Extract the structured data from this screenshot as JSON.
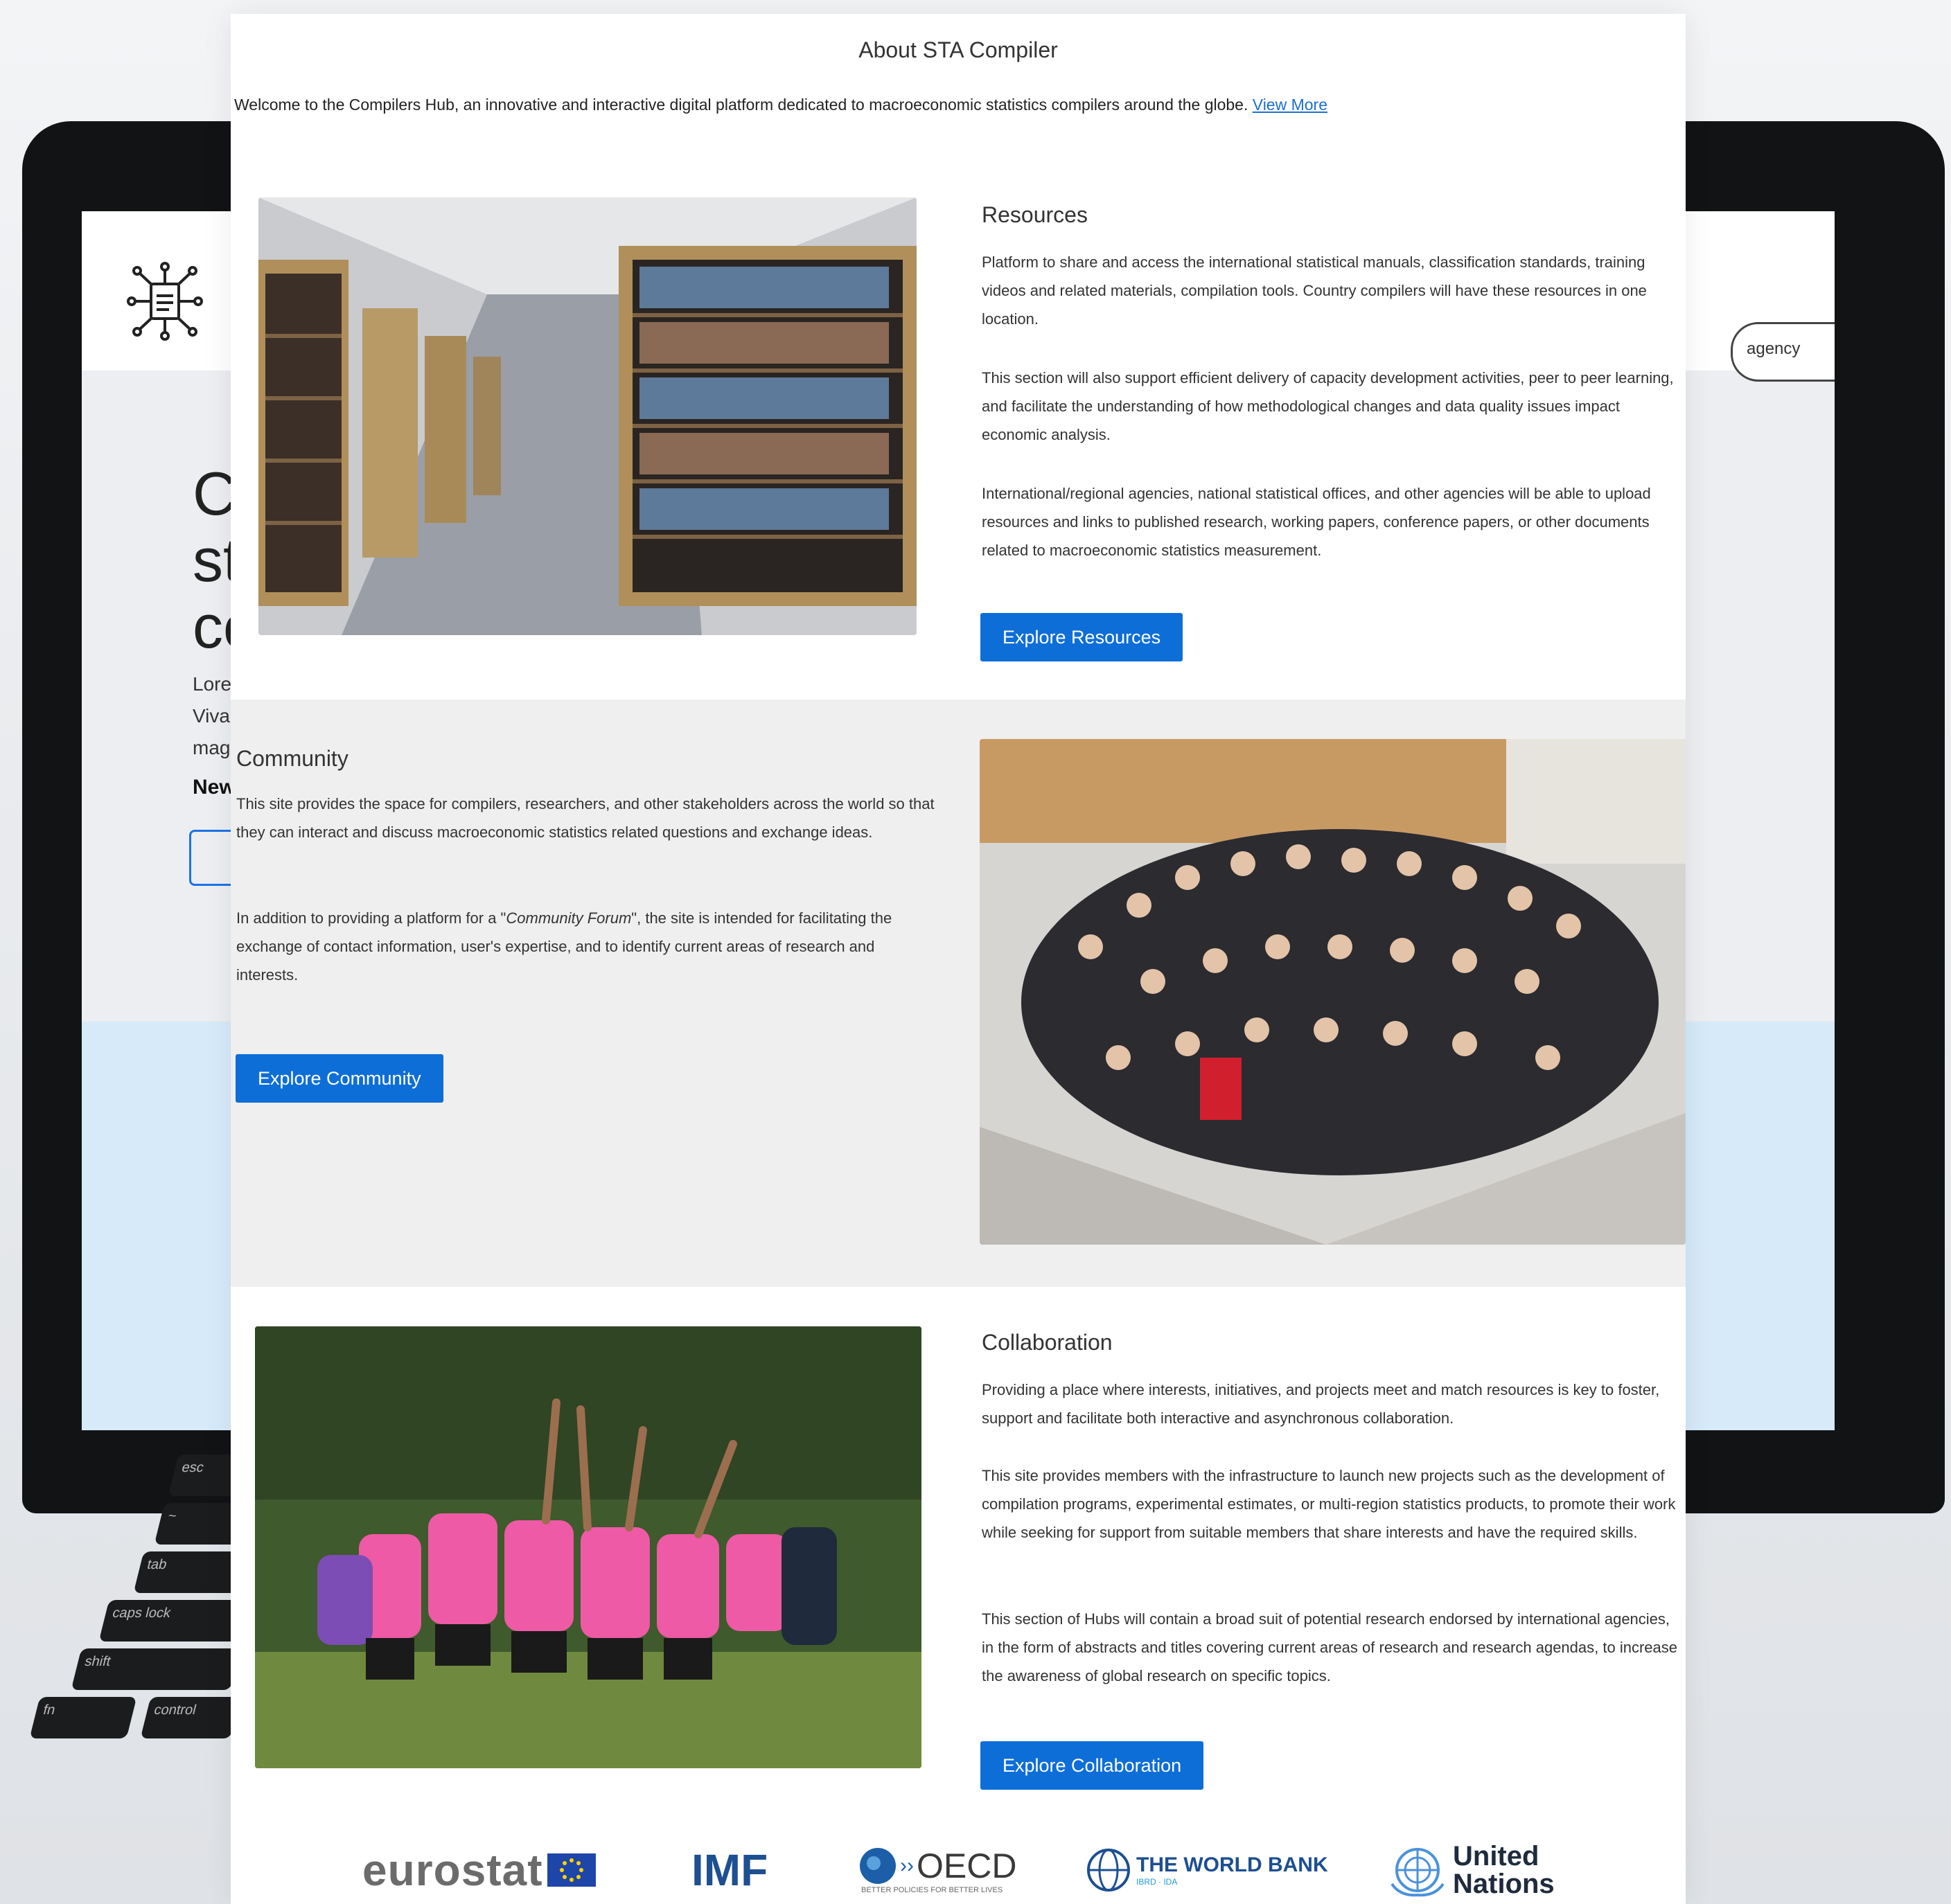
{
  "background_screen": {
    "hero_fragments": [
      "Co",
      "st",
      "co"
    ],
    "text_fragments": [
      "Lore",
      "Vivar",
      "magr"
    ],
    "new_label": "New",
    "search_placeholder": "agency",
    "keys": [
      "esc",
      "~",
      "tab",
      "caps lock",
      "shift",
      "fn",
      "control"
    ]
  },
  "page": {
    "title": "About STA Compiler",
    "intro_text": "Welcome to the Compilers Hub, an innovative and interactive digital platform dedicated to macroeconomic statistics compilers around the globe.",
    "view_more": "View More"
  },
  "resources": {
    "heading": "Resources",
    "paragraphs": [
      "Platform to share and access the international statistical manuals, classification standards, training videos and related materials, compilation tools. Country compilers will have these resources in one location.",
      "This section will also support efficient delivery of capacity development activities, peer to peer learning, and facilitate the understanding of how methodological changes and data quality issues impact economic analysis.",
      "International/regional agencies, national statistical offices, and other agencies will be able to upload resources and links to published research, working papers, conference papers, or other documents related to macroeconomic statistics measurement."
    ],
    "button": "Explore Resources"
  },
  "community": {
    "heading": "Community",
    "paragraph1": "This site provides the space for compilers, researchers, and other stakeholders across the world so that they can interact and discuss macroeconomic statistics related questions and exchange ideas.",
    "paragraph2_before": "In addition to providing a platform for a \"",
    "paragraph2_em": "Community Forum",
    "paragraph2_after": "\", the site is intended for facilitating the exchange of contact information, user's expertise, and to identify current areas of research and interests.",
    "button": "Explore Community"
  },
  "collaboration": {
    "heading": "Collaboration",
    "paragraphs": [
      "Providing a place where interests, initiatives, and projects meet and match resources is key to foster, support and facilitate both interactive and asynchronous collaboration.",
      "This site provides members with the infrastructure to launch new projects such as the development of compilation programs, experimental estimates, or multi-region statistics products, to promote their work while seeking for support from suitable members that share interests and have the required skills.",
      "This section of Hubs will contain a broad suit of potential research endorsed by international agencies, in the form of abstracts and titles covering current areas of research and research agendas, to increase the awareness of global research on specific topics."
    ],
    "button": "Explore Collaboration"
  },
  "partners": {
    "eurostat": "eurostat",
    "imf": "IMF",
    "oecd": "OECD",
    "oecd_tagline": "BETTER POLICIES FOR BETTER LIVES",
    "worldbank": "THE WORLD BANK",
    "worldbank_sub": "IBRD · IDA",
    "un_line1": "United",
    "un_line2": "Nations"
  },
  "colors": {
    "button_blue": "#0e6ed8",
    "link_blue": "#1a6fd1",
    "band_gray": "#efefef"
  },
  "icons": [
    "search-icon",
    "hub-logo-icon",
    "eu-flag-icon",
    "oecd-globe-icon",
    "worldbank-globe-icon",
    "un-emblem-icon"
  ]
}
